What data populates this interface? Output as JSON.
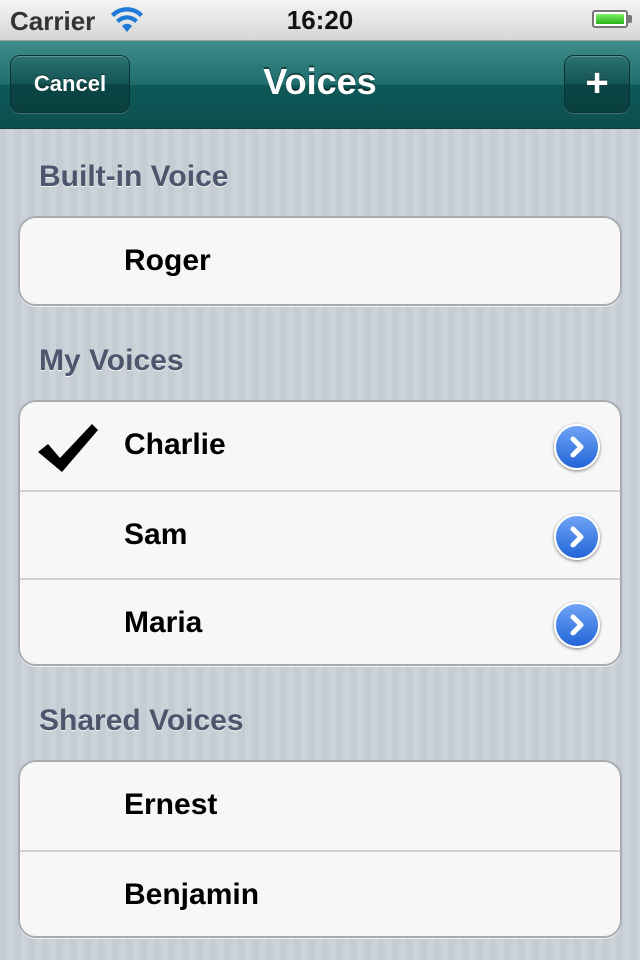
{
  "status_bar": {
    "carrier": "Carrier",
    "time": "16:20",
    "battery_level": 1.0
  },
  "nav": {
    "title": "Voices",
    "cancel_label": "Cancel",
    "add_label": "+"
  },
  "sections": {
    "builtin": {
      "header": "Built-in Voice",
      "items": [
        {
          "label": "Roger"
        }
      ]
    },
    "my": {
      "header": "My Voices",
      "items": [
        {
          "label": "Charlie",
          "selected": true,
          "icon": "disclosure-icon"
        },
        {
          "label": "Sam",
          "icon": "disclosure-icon"
        },
        {
          "label": "Maria",
          "icon": "disclosure-icon"
        }
      ]
    },
    "shared": {
      "header": "Shared Voices",
      "items": [
        {
          "label": "Ernest"
        },
        {
          "label": "Benjamin"
        }
      ]
    }
  },
  "colors": {
    "nav_bar": "#1f6d6d",
    "section_header": "#4c566c",
    "disclosure": "#2365d8",
    "battery": "#29b218"
  }
}
